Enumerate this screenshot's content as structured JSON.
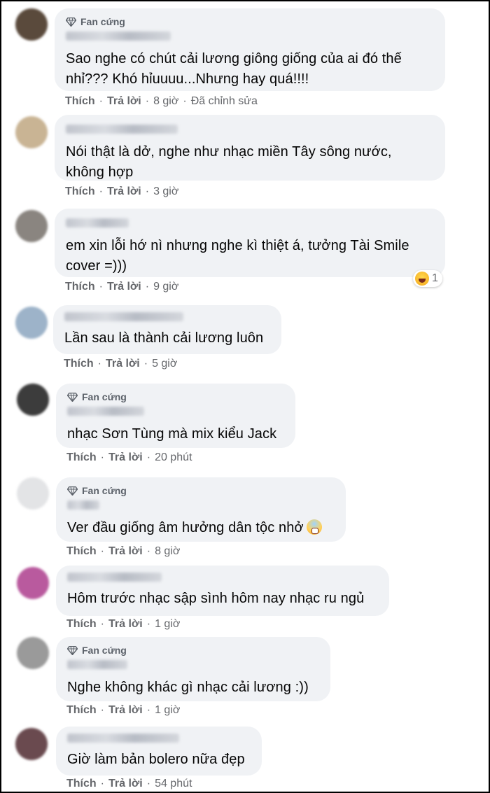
{
  "badge_label": "Fan cứng",
  "action_like": "Thích",
  "action_reply": "Trả lời",
  "separator": "·",
  "comments": [
    {
      "badge": true,
      "text": "Sao nghe có chút cải lương giông giống của ai đó thế nhỉ??? Khó hỉuuuu...Nhưng hay quá!!!!",
      "time": "8 giờ",
      "extra": "Đã chỉnh sửa",
      "avatar_color": "#5a4a3c"
    },
    {
      "badge": false,
      "text": "Nói thật là dở, nghe như nhạc miền Tây sông nước, không hợp",
      "time": "3 giờ",
      "avatar_color": "#c9b494"
    },
    {
      "badge": false,
      "text": "em xin lỗi hớ nì nhưng nghe kì thiệt á, tưởng Tài Smile cover =)))",
      "time": "9 giờ",
      "reaction_count": "1",
      "reaction_icon": "laughing-emoji-icon",
      "avatar_color": "#8a8580"
    },
    {
      "badge": false,
      "text": "Lần sau là thành cải lương luôn",
      "time": "5 giờ",
      "avatar_color": "#9db3c9"
    },
    {
      "badge": true,
      "text": "nhạc Sơn Tùng mà mix kiểu Jack",
      "time": "20 phút",
      "avatar_color": "#3c3c3c"
    },
    {
      "badge": true,
      "text": "Ver đầu giống âm hưởng dân tộc nhở",
      "emoji": "fearful-face-emoji-icon",
      "time": "8 giờ",
      "avatar_color": "#e3e4e6"
    },
    {
      "badge": false,
      "text": "Hôm trước nhạc sập sình hôm nay nhạc ru ngủ",
      "time": "1 giờ",
      "avatar_color": "#b95a9e"
    },
    {
      "badge": true,
      "text": "Nghe không khác gì nhạc cải lương :))",
      "time": "1 giờ",
      "avatar_color": "#9a9a9a"
    },
    {
      "badge": false,
      "text": "Giờ làm bản bolero nữa đẹp",
      "time": "54 phút",
      "avatar_color": "#6a4a4f"
    }
  ],
  "colors": {
    "bubble_bg": "#f0f2f5",
    "meta_text": "#65676b",
    "body_text": "#050505"
  }
}
